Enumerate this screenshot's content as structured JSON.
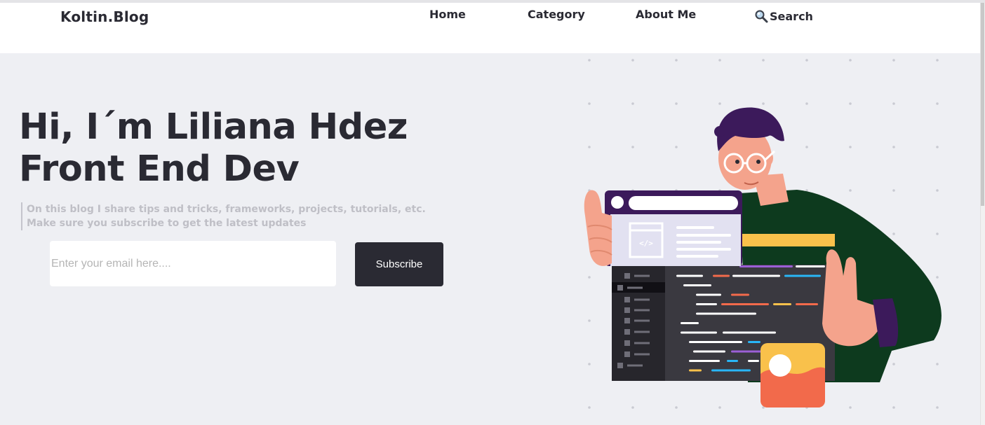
{
  "header": {
    "logo": "Koltin.Blog",
    "nav": {
      "home": "Home",
      "category": "Category",
      "about": "About Me",
      "search": "Search"
    }
  },
  "hero": {
    "title_line1": "Hi, I´m Liliana Hdez",
    "title_line2": "Front End Dev",
    "tagline_line1": "On this blog I share tips and tricks, frameworks, projects, tutorials, etc.",
    "tagline_line2": "Make sure you subscribe to get the latest updates",
    "email_placeholder": "Enter your email here....",
    "subscribe_label": "Subscribe"
  },
  "colors": {
    "text_dark": "#2a2a33",
    "hero_bg": "#eeeff3",
    "button_bg": "#2a2a33",
    "tagline": "#bfbfc6"
  },
  "icons": {
    "search": "magnifier-icon",
    "illustration": "developer-with-code-window-illustration"
  }
}
